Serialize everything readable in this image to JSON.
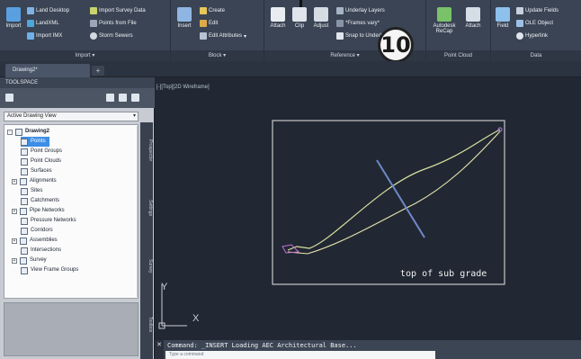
{
  "ribbon": {
    "import_panel": {
      "title": "Import",
      "big_import": "Import",
      "items": [
        "Land Desktop",
        "Import Survey Data",
        "LandXML",
        "Points from File",
        "Import IMX",
        "Storm Sewers"
      ]
    },
    "block_panel": {
      "title": "Block",
      "big_insert": "Insert",
      "items": [
        "Create",
        "Edit",
        "Edit Attributes"
      ]
    },
    "reference_panel": {
      "title": "Reference",
      "big": [
        "Attach",
        "Clip",
        "Adjust"
      ],
      "items": [
        "Underlay Layers",
        "*Frames vary*",
        "Snap to Underlays ON"
      ]
    },
    "pointcloud_panel": {
      "title": "Point Cloud",
      "big": [
        "Autodesk ReCap",
        "Attach"
      ]
    },
    "data_panel": {
      "title": "Data",
      "big_field": "Field",
      "items": [
        "Update Fields",
        "OLE Object",
        "Hyperlink"
      ]
    },
    "step_badge": "10"
  },
  "tabs": {
    "active": "Drawing2*",
    "new_tab": "+"
  },
  "toolspace": {
    "header": "TOOLSPACE",
    "view_select": "Active Drawing View",
    "tree": [
      {
        "label": "Drawing2",
        "level": 0,
        "bold": true,
        "expander": "-"
      },
      {
        "label": "Points",
        "level": 1,
        "selected": true
      },
      {
        "label": "Point Groups",
        "level": 1
      },
      {
        "label": "Point Clouds",
        "level": 1
      },
      {
        "label": "Surfaces",
        "level": 1
      },
      {
        "label": "Alignments",
        "level": 1,
        "expander": "+"
      },
      {
        "label": "Sites",
        "level": 1
      },
      {
        "label": "Catchments",
        "level": 1
      },
      {
        "label": "Pipe Networks",
        "level": 1,
        "expander": "+"
      },
      {
        "label": "Pressure Networks",
        "level": 1
      },
      {
        "label": "Corridors",
        "level": 1
      },
      {
        "label": "Assemblies",
        "level": 1,
        "expander": "+"
      },
      {
        "label": "Intersections",
        "level": 1
      },
      {
        "label": "Survey",
        "level": 1,
        "expander": "+"
      },
      {
        "label": "View Frame Groups",
        "level": 1
      }
    ],
    "vtabs": [
      "Prospector",
      "Settings",
      "Survey",
      "Toolbox"
    ]
  },
  "canvas": {
    "viewport_label": "[-][Top][2D Wireframe]",
    "annotation": "top of sub grade",
    "ucs_y": "Y",
    "ucs_x": "X",
    "colors": {
      "background": "#212833",
      "frame": "#e6e6e6",
      "profile_a": "#d9e2a0",
      "profile_b": "#e8e6b0",
      "crossline": "#6f88c8"
    }
  },
  "command": {
    "close": "✕",
    "history": "Command: _INSERT Loading AEC Architectural Base...",
    "placeholder": "Type a command"
  }
}
